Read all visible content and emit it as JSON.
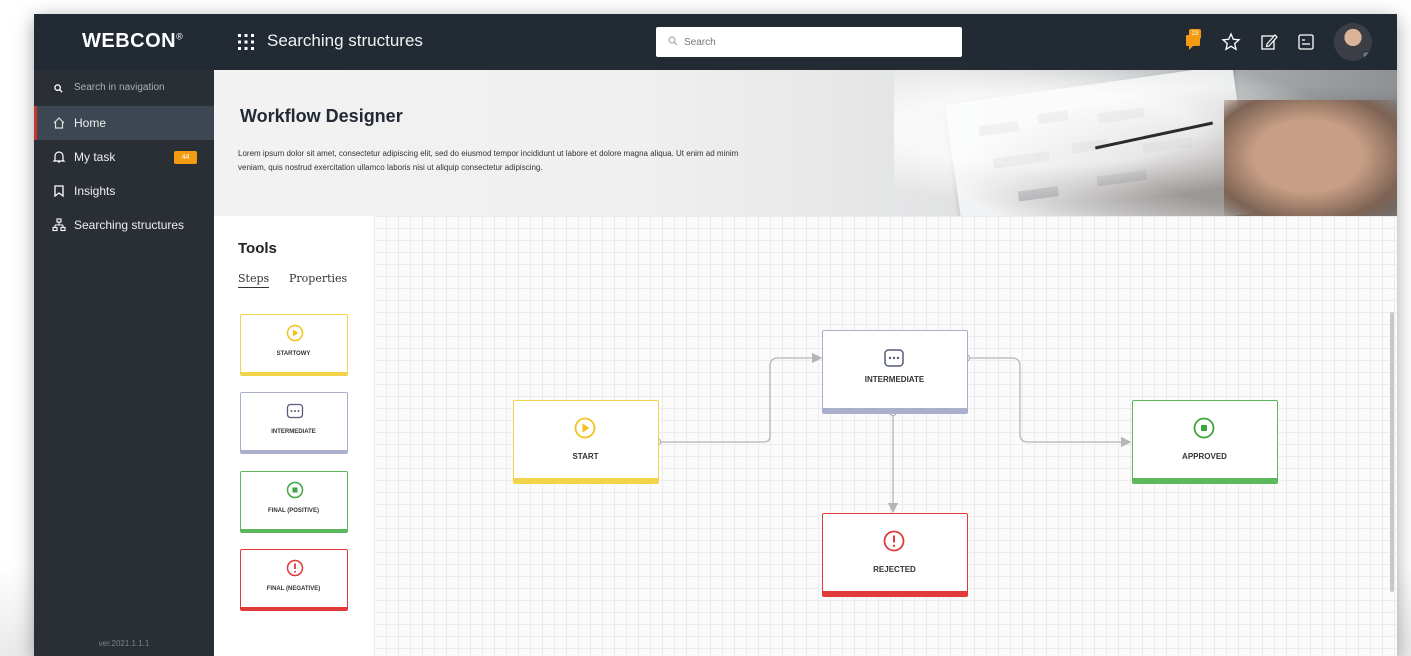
{
  "colors": {
    "topbar": "#222a33",
    "sidebar": "#2a2f36",
    "accent_badge": "#f39c12",
    "start": "#f2d44b",
    "intermediate": "#aab0cc",
    "positive": "#5cb85c",
    "negative": "#e03a3a"
  },
  "header": {
    "logo": "WEBCON",
    "logo_mark": "®",
    "app_title": "Searching structures",
    "search_placeholder": "Search",
    "notification_count": "23",
    "icons": [
      "notification-icon",
      "star-icon",
      "edit-icon",
      "tasks-icon",
      "avatar"
    ]
  },
  "sidebar": {
    "search_label": "Search in navigation",
    "items": [
      {
        "label": "Home",
        "icon": "home-icon",
        "active": true
      },
      {
        "label": "My task",
        "icon": "bell-icon",
        "badge": "44"
      },
      {
        "label": "Insights",
        "icon": "bookmark-icon"
      },
      {
        "label": "Searching structures",
        "icon": "hierarchy-icon"
      }
    ],
    "version": "ver.2021.1.1.1"
  },
  "banner": {
    "title": "Workflow Designer",
    "description": "Lorem ipsum dolor sit amet, consectetur adipiscing elit, sed do eiusmod tempor incididunt ut labore et dolore magna aliqua. Ut enim ad minim veniam, quis nostrud exercitation ullamco laboris nisi ut aliquip consectetur adipiscing."
  },
  "tools": {
    "title": "Tools",
    "tabs": [
      "Steps",
      "Properties"
    ],
    "cards": [
      {
        "label": "STARTOWY",
        "icon": "play-icon"
      },
      {
        "label": "INTERMEDIATE",
        "icon": "ellipsis-icon"
      },
      {
        "label": "FINAL (POSITIVE)",
        "icon": "stop-icon"
      },
      {
        "label": "FINAL (NEGATIVE)",
        "icon": "alert-icon"
      }
    ]
  },
  "canvas": {
    "nodes": [
      {
        "label": "START",
        "icon": "play-icon"
      },
      {
        "label": "INTERMEDIATE",
        "icon": "ellipsis-icon"
      },
      {
        "label": "APPROVED",
        "icon": "stop-icon"
      },
      {
        "label": "REJECTED",
        "icon": "alert-icon"
      }
    ]
  }
}
